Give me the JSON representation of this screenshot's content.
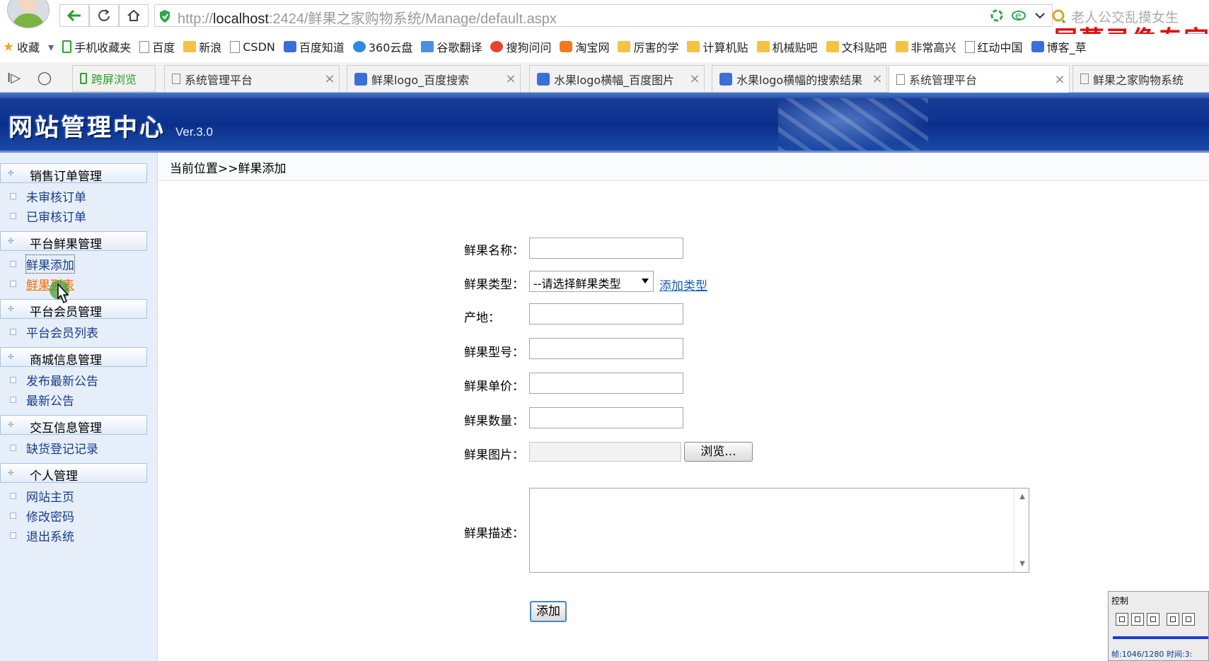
{
  "browser": {
    "url_host": "localhost",
    "url_prefix": "http://",
    "url_rest": ":2424/鲜果之家购物系统/Manage/default.aspx",
    "search_text": "老人公交乱摸女生",
    "watermark": "屏幕录像专家",
    "bookmarks": [
      {
        "label": "收藏",
        "icon": "star-icon"
      },
      {
        "label": "手机收藏夹",
        "icon": "phone-icon"
      },
      {
        "label": "百度",
        "icon": "page-icon"
      },
      {
        "label": "新浪",
        "icon": "folder-icon"
      },
      {
        "label": "CSDN",
        "icon": "page-icon"
      },
      {
        "label": "百度知道",
        "icon": "paw-icon"
      },
      {
        "label": "360云盘",
        "icon": "cloud-icon"
      },
      {
        "label": "谷歌翻译",
        "icon": "translate-icon"
      },
      {
        "label": "搜狗问问",
        "icon": "sogou-icon"
      },
      {
        "label": "淘宝网",
        "icon": "taobao-icon"
      },
      {
        "label": "厉害的学",
        "icon": "folder-icon"
      },
      {
        "label": "计算机贴",
        "icon": "folder-icon"
      },
      {
        "label": "机械贴吧",
        "icon": "folder-icon"
      },
      {
        "label": "文科贴吧",
        "icon": "folder-icon"
      },
      {
        "label": "非常高兴",
        "icon": "folder-icon"
      },
      {
        "label": "红动中国",
        "icon": "page-icon"
      },
      {
        "label": "博客_草",
        "icon": "paw-icon"
      }
    ],
    "tabs": [
      {
        "label": "跨屏浏览",
        "icon": "phone-icon"
      },
      {
        "label": "系统管理平台",
        "icon": "page-icon"
      },
      {
        "label": "鲜果logo_百度搜索",
        "icon": "paw-icon"
      },
      {
        "label": "水果logo横幅_百度图片",
        "icon": "paw-icon"
      },
      {
        "label": "水果logo横幅的搜索结果",
        "icon": "paw-icon"
      },
      {
        "label": "系统管理平台",
        "icon": "page-icon"
      },
      {
        "label": "鲜果之家购物系统",
        "icon": "page-icon"
      }
    ]
  },
  "banner": {
    "title": "网站管理中心",
    "version": "Ver.3.0"
  },
  "sidebar": {
    "groups": [
      {
        "label": "销售订单管理",
        "items": [
          "未审核订单",
          "已审核订单"
        ]
      },
      {
        "label": "平台鲜果管理",
        "items": [
          "鲜果添加",
          "鲜果列表"
        ]
      },
      {
        "label": "平台会员管理",
        "items": [
          "平台会员列表"
        ]
      },
      {
        "label": "商城信息管理",
        "items": [
          "发布最新公告",
          "最新公告"
        ]
      },
      {
        "label": "交互信息管理",
        "items": [
          "缺货登记记录"
        ]
      },
      {
        "label": "个人管理",
        "items": [
          "网站主页",
          "修改密码",
          "退出系统"
        ]
      }
    ]
  },
  "breadcrumb": "当前位置>>鲜果添加",
  "form": {
    "name_label": "鲜果名称：",
    "type_label": "鲜果类型：",
    "type_selected": "--请选择鲜果类型",
    "add_type_link": "添加类型",
    "origin_label": "产地：",
    "model_label": "鲜果型号：",
    "price_label": "鲜果单价：",
    "quantity_label": "鲜果数量：",
    "image_label": "鲜果图片：",
    "browse_label": "浏览...",
    "desc_label": "鲜果描述：",
    "submit_label": "添加"
  },
  "recorder": {
    "title": "控制",
    "status": "帧:1046/1280 时间:3:"
  },
  "colors": {
    "banner": "#0d3492",
    "sidebar_bg": "#e6eff9",
    "link": "#1560c0",
    "hover": "#ff6a00",
    "watermark": "#e01010"
  }
}
